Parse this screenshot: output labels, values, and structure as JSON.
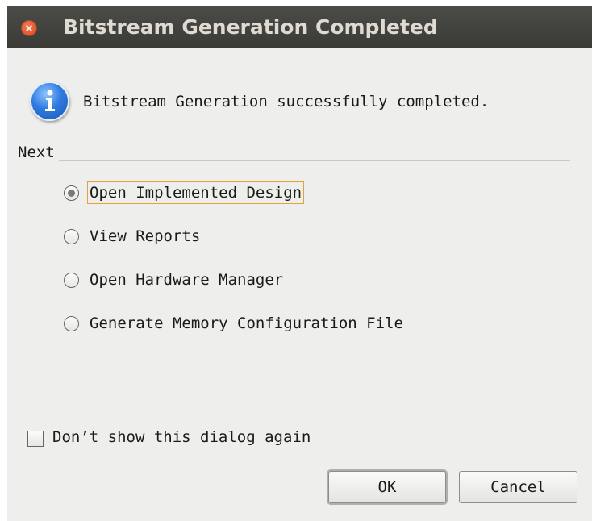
{
  "window": {
    "title": "Bitstream Generation Completed"
  },
  "message": "Bitstream Generation successfully completed.",
  "next_section": {
    "label": "Next",
    "options": [
      {
        "label": "Open Implemented Design",
        "selected": true
      },
      {
        "label": "View Reports",
        "selected": false
      },
      {
        "label": "Open Hardware Manager",
        "selected": false
      },
      {
        "label": "Generate Memory Configuration File",
        "selected": false
      }
    ]
  },
  "dont_show": {
    "label": "Don’t show this dialog again",
    "checked": false
  },
  "buttons": {
    "ok": "OK",
    "cancel": "Cancel"
  },
  "icons": {
    "close": "close-icon",
    "info": "info-icon"
  },
  "colors": {
    "titlebar": "#3f3f3c",
    "close": "#e05a2b",
    "info": "#2f7be0",
    "focus": "#e3a33a"
  }
}
